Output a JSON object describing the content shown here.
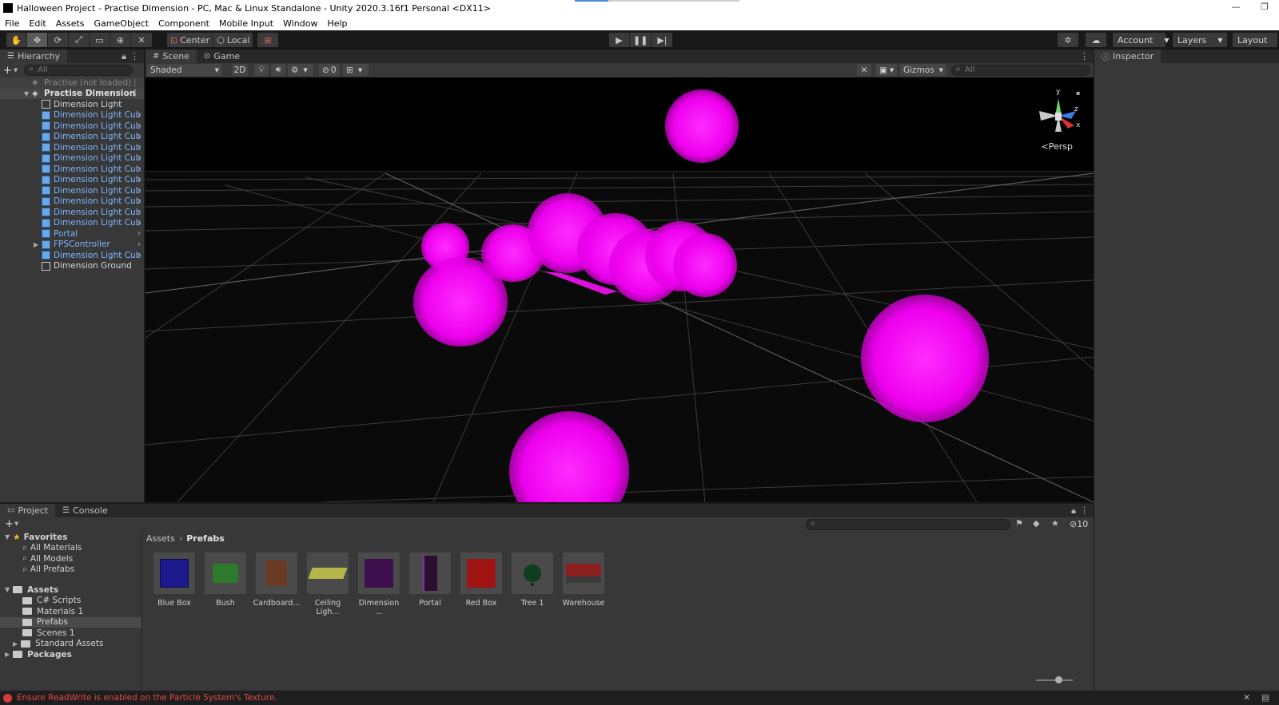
{
  "window": {
    "title": "Halloween Project - Practise Dimension - PC, Mac & Linux Standalone - Unity 2020.3.16f1 Personal <DX11>",
    "minimize": "—",
    "maximize": "❐"
  },
  "menu": [
    "File",
    "Edit",
    "Assets",
    "GameObject",
    "Component",
    "Mobile Input",
    "Window",
    "Help"
  ],
  "toolbar": {
    "pivot_mode": "Center",
    "pivot_rotation": "Local",
    "account_label": "Account",
    "layers_label": "Layers",
    "layout_label": "Layout"
  },
  "hierarchy": {
    "tab_label": "Hierarchy",
    "search_placeholder": "All",
    "items": [
      {
        "label": "Practise (not loaded)",
        "kind": "scene-unloaded"
      },
      {
        "label": "Practise Dimension",
        "kind": "scene"
      },
      {
        "label": "Dimension Light",
        "kind": "object"
      },
      {
        "label": "Dimension Light Cub",
        "kind": "prefab"
      },
      {
        "label": "Dimension Light Cub",
        "kind": "prefab"
      },
      {
        "label": "Dimension Light Cub",
        "kind": "prefab"
      },
      {
        "label": "Dimension Light Cub",
        "kind": "prefab"
      },
      {
        "label": "Dimension Light Cub",
        "kind": "prefab"
      },
      {
        "label": "Dimension Light Cub",
        "kind": "prefab"
      },
      {
        "label": "Dimension Light Cub",
        "kind": "prefab"
      },
      {
        "label": "Dimension Light Cub",
        "kind": "prefab"
      },
      {
        "label": "Dimension Light Cub",
        "kind": "prefab"
      },
      {
        "label": "Dimension Light Cub",
        "kind": "prefab"
      },
      {
        "label": "Dimension Light Cub",
        "kind": "prefab"
      },
      {
        "label": "Portal",
        "kind": "prefab"
      },
      {
        "label": "FPSController",
        "kind": "prefab"
      },
      {
        "label": "Dimension Light Cub",
        "kind": "prefab"
      },
      {
        "label": "Dimension Ground",
        "kind": "object"
      }
    ]
  },
  "scene": {
    "tabs": [
      "Scene",
      "Game"
    ],
    "draw_mode": "Shaded",
    "mode_2d": "2D",
    "hidden_count": "0",
    "gizmos_label": "Gizmos",
    "search_placeholder": "All",
    "projection": "Persp",
    "axis_y": "y",
    "axis_z": "z",
    "axis_x": "x"
  },
  "inspector": {
    "tab_label": "Inspector"
  },
  "project": {
    "tabs": [
      "Project",
      "Console"
    ],
    "hidden_count": "10",
    "breadcrumb_root": "Assets",
    "breadcrumb_current": "Prefabs",
    "tree": [
      {
        "label": "Favorites",
        "kind": "section"
      },
      {
        "label": "All Materials",
        "kind": "search"
      },
      {
        "label": "All Models",
        "kind": "search"
      },
      {
        "label": "All Prefabs",
        "kind": "search"
      },
      {
        "label": "Assets",
        "kind": "section"
      },
      {
        "label": "C# Scripts",
        "kind": "folder"
      },
      {
        "label": "Materials 1",
        "kind": "folder"
      },
      {
        "label": "Prefabs",
        "kind": "folder",
        "selected": true
      },
      {
        "label": "Scenes 1",
        "kind": "folder"
      },
      {
        "label": "Standard Assets",
        "kind": "folder"
      },
      {
        "label": "Packages",
        "kind": "section"
      }
    ],
    "assets": [
      {
        "label": "Blue Box",
        "color": "#1a1a8c"
      },
      {
        "label": "Bush",
        "color": "#2d7a2d"
      },
      {
        "label": "Cardboard...",
        "color": "#6b3a22"
      },
      {
        "label": "Ceiling Ligh...",
        "color": "#b5b54a"
      },
      {
        "label": "Dimension ...",
        "color": "#3d0f4d"
      },
      {
        "label": "Portal",
        "color": "#2a0f33"
      },
      {
        "label": "Red Box",
        "color": "#a01414"
      },
      {
        "label": "Tree 1",
        "color": "#0f3d1f"
      },
      {
        "label": "Warehouse",
        "color": "#8c1f1f"
      }
    ]
  },
  "status": {
    "message": "Ensure ReadWrite is enabled on the Particle System's Texture."
  },
  "colors": {
    "accent_magenta": "#ff00ff",
    "prefab_blue": "#7eb6ff",
    "error_red": "#e04848"
  }
}
